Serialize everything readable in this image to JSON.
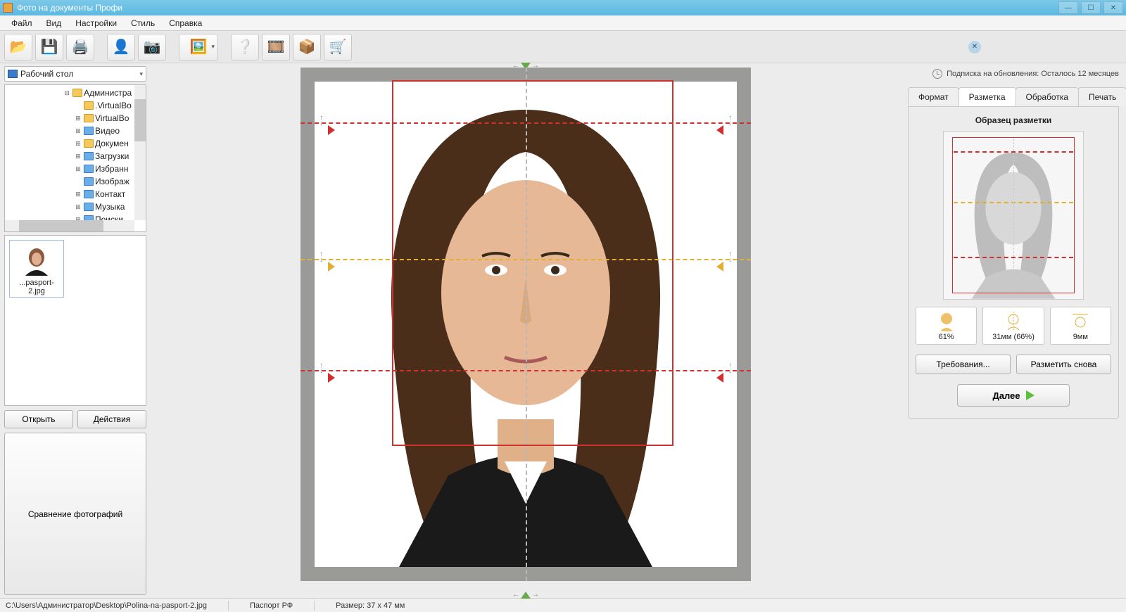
{
  "title": "Фото на документы Профи",
  "menu": {
    "file": "Файл",
    "view": "Вид",
    "settings": "Настройки",
    "style": "Стиль",
    "help": "Справка"
  },
  "drive": "Рабочий стол",
  "tree": [
    {
      "expander": "⊟",
      "blue": false,
      "label": "Администра"
    },
    {
      "expander": "",
      "blue": false,
      "label": ".VirtualBo"
    },
    {
      "expander": "⊞",
      "blue": false,
      "label": "VirtualBo"
    },
    {
      "expander": "⊞",
      "blue": true,
      "label": "Видео"
    },
    {
      "expander": "⊞",
      "blue": false,
      "label": "Докумен"
    },
    {
      "expander": "⊞",
      "blue": true,
      "label": "Загрузки"
    },
    {
      "expander": "⊞",
      "blue": true,
      "label": "Избранн"
    },
    {
      "expander": "",
      "blue": true,
      "label": "Изображ"
    },
    {
      "expander": "⊞",
      "blue": true,
      "label": "Контакт"
    },
    {
      "expander": "⊞",
      "blue": true,
      "label": "Музыка"
    },
    {
      "expander": "⊞",
      "blue": true,
      "label": "Поиски"
    }
  ],
  "thumbnail": {
    "label": "...pasport-2.jpg"
  },
  "buttons": {
    "open": "Открыть",
    "actions": "Действия",
    "compare": "Сравнение фотографий"
  },
  "subscription": "Подписка на обновления: Осталось 12 месяцев",
  "tabs": {
    "format": "Формат",
    "markup": "Разметка",
    "processing": "Обработка",
    "print": "Печать"
  },
  "panel": {
    "title": "Образец разметки",
    "metric1": "61%",
    "metric2": "31мм (66%)",
    "metric3": "9мм",
    "requirements": "Требования...",
    "remark": "Разметить снова",
    "next": "Далее"
  },
  "status": {
    "path": "C:\\Users\\Администратор\\Desktop\\Polina-na-pasport-2.jpg",
    "doc": "Паспорт РФ",
    "size": "Размер: 37 x 47 мм"
  }
}
